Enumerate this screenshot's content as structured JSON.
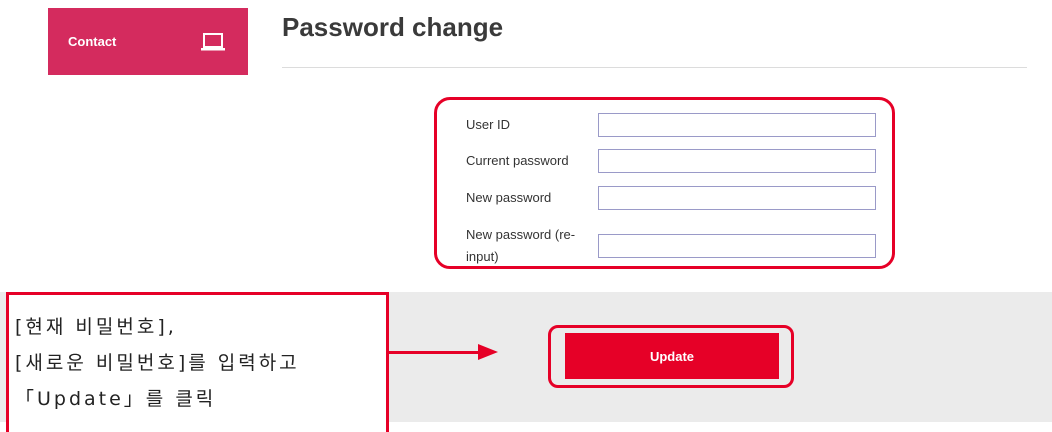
{
  "sidebar": {
    "contact_label": "Contact",
    "contact_icon": "laptop-icon",
    "contact_color": "#d42b5e"
  },
  "page": {
    "title": "Password change"
  },
  "form": {
    "fields": [
      {
        "label": "User ID",
        "value": ""
      },
      {
        "label": "Current password",
        "value": ""
      },
      {
        "label": "New password",
        "value": ""
      },
      {
        "label_line1": "New password (re-",
        "label_line2": "input)",
        "value": ""
      }
    ],
    "update_label": "Update",
    "accent_color": "#e60027"
  },
  "annotation": {
    "line1": "[현재 비밀번호],",
    "line2": "[새로운 비밀번호]를 입력하고",
    "line3": "「Update」를 클릭"
  }
}
